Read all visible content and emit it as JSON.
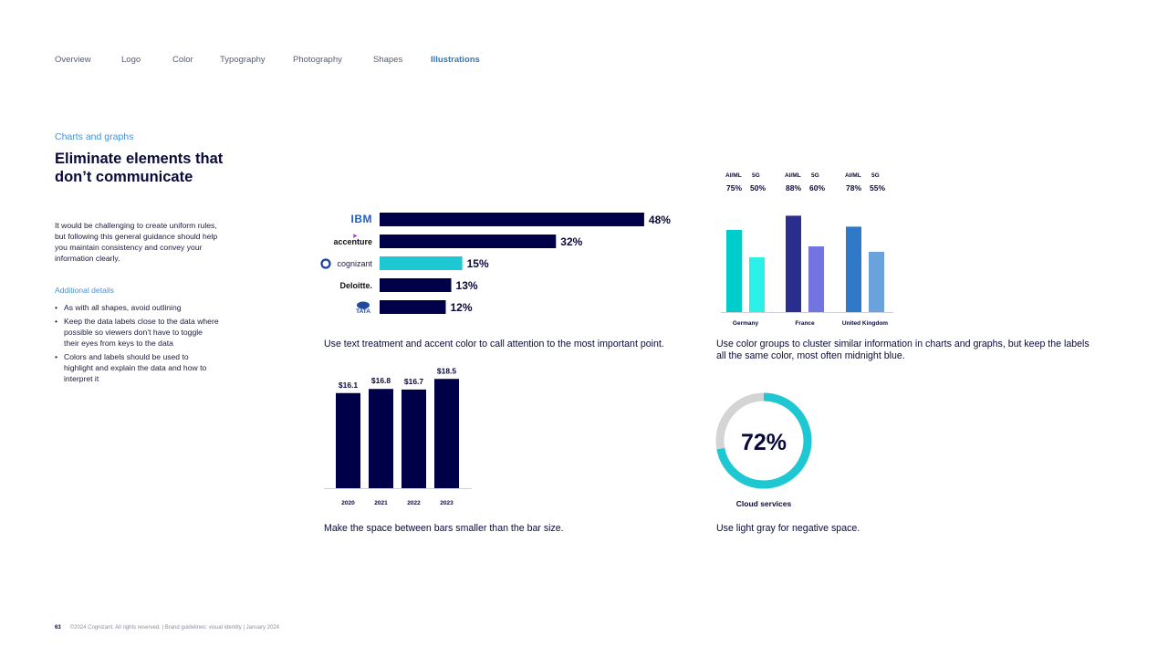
{
  "nav": {
    "items": [
      "Overview",
      "Logo",
      "Color",
      "Typography",
      "Photography",
      "Shapes",
      "Illustrations"
    ],
    "active_index": 6
  },
  "left": {
    "eyebrow": "Charts and graphs",
    "heading": "Eliminate elements that don’t communicate",
    "body": "It would be challenging to create uniform rules, but following this general guidance should help you maintain consistency and convey your information clearly.",
    "details_label": "Additional details",
    "bullets": [
      "As with all shapes, avoid outlining",
      "Keep the data labels close to the data where possible so viewers don’t have to toggle their eyes from keys to the data",
      "Colors and labels should be used to highlight and explain the data and how to interpret it"
    ]
  },
  "captions": {
    "hbar": "Use text treatment and accent color to call attention to the most important point.",
    "grouped": "Use color groups to cluster similar information in charts and graphs, but keep the labels all the same color, most often midnight blue.",
    "vbar": "Make the space between bars smaller than the bar size.",
    "donut": "Use light gray for negative space."
  },
  "colors": {
    "midnight": "#000048",
    "accent": "#1ec8d2",
    "nav_active": "#2f78c4",
    "light_gray": "#d4d4d4"
  },
  "chart_data": [
    {
      "type": "bar",
      "orientation": "horizontal",
      "categories": [
        "IBM",
        "accenture",
        "cognizant",
        "Deloitte.",
        "TATA"
      ],
      "values": [
        48,
        32,
        15,
        13,
        12
      ],
      "value_labels": [
        "48%",
        "32%",
        "15%",
        "13%",
        "12%"
      ],
      "highlight": "cognizant",
      "xlim": [
        0,
        50
      ]
    },
    {
      "type": "bar",
      "categories": [
        "Germany",
        "France",
        "United Kingdom"
      ],
      "series": [
        {
          "name": "AI/ML",
          "values": [
            75,
            88,
            78
          ]
        },
        {
          "name": "5G",
          "values": [
            50,
            60,
            55
          ]
        }
      ],
      "value_labels": [
        [
          "75%",
          "50%"
        ],
        [
          "88%",
          "60%"
        ],
        [
          "78%",
          "55%"
        ]
      ],
      "group_colors": [
        [
          "#00cccc",
          "#2af0e8"
        ],
        [
          "#2a2f8f",
          "#7474e0"
        ],
        [
          "#2f79c8",
          "#6aa2de"
        ]
      ],
      "ylim": [
        0,
        100
      ]
    },
    {
      "type": "bar",
      "categories": [
        "2020",
        "2021",
        "2022",
        "2023"
      ],
      "values": [
        16.1,
        16.8,
        16.7,
        18.5
      ],
      "value_labels": [
        "$16.1",
        "$16.8",
        "$16.7",
        "$18.5"
      ],
      "ylim": [
        0,
        19
      ]
    },
    {
      "type": "pie",
      "style": "donut",
      "value": 72,
      "center_label": "72%",
      "label": "Cloud services"
    }
  ],
  "footer": {
    "page": "63",
    "text": "©2024 Cognizant. All rights reserved.  |  Brand guidelines: visual identity  |  January 2024"
  }
}
